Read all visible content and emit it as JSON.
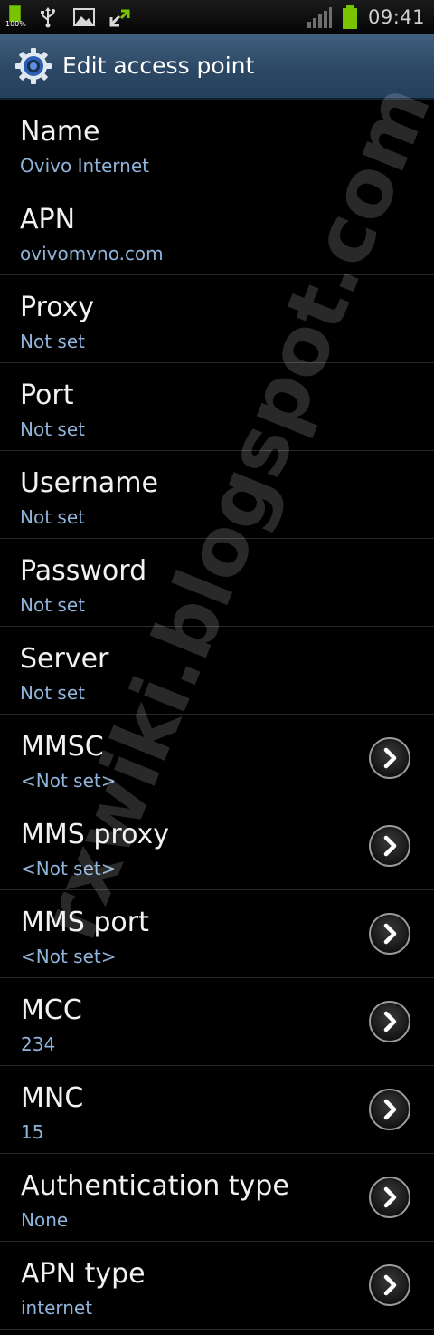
{
  "status_bar": {
    "battery_small_label": "100%",
    "time": "09:41",
    "icons": [
      "battery-small-icon",
      "usb-icon",
      "image-icon",
      "sync-icon",
      "signal-icon",
      "battery-icon"
    ],
    "accent_color": "#79c300"
  },
  "header": {
    "title": "Edit access point",
    "icon": "gear-icon",
    "background": "#2c4865"
  },
  "watermark": "rxwiki.blogspot.com",
  "settings": [
    {
      "title": "Name",
      "value": "Ovivo Internet",
      "chevron": false
    },
    {
      "title": "APN",
      "value": "ovivomvno.com",
      "chevron": false
    },
    {
      "title": "Proxy",
      "value": "Not set",
      "chevron": false
    },
    {
      "title": "Port",
      "value": "Not set",
      "chevron": false
    },
    {
      "title": "Username",
      "value": "Not set",
      "chevron": false
    },
    {
      "title": "Password",
      "value": "Not set",
      "chevron": false
    },
    {
      "title": "Server",
      "value": "Not set",
      "chevron": false
    },
    {
      "title": "MMSC",
      "value": "<Not set>",
      "chevron": true
    },
    {
      "title": "MMS proxy",
      "value": "<Not set>",
      "chevron": true
    },
    {
      "title": "MMS port",
      "value": "<Not set>",
      "chevron": true
    },
    {
      "title": "MCC",
      "value": "234",
      "chevron": true
    },
    {
      "title": "MNC",
      "value": "15",
      "chevron": true
    },
    {
      "title": "Authentication type",
      "value": "None",
      "chevron": true
    },
    {
      "title": "APN type",
      "value": "internet",
      "chevron": true
    }
  ]
}
